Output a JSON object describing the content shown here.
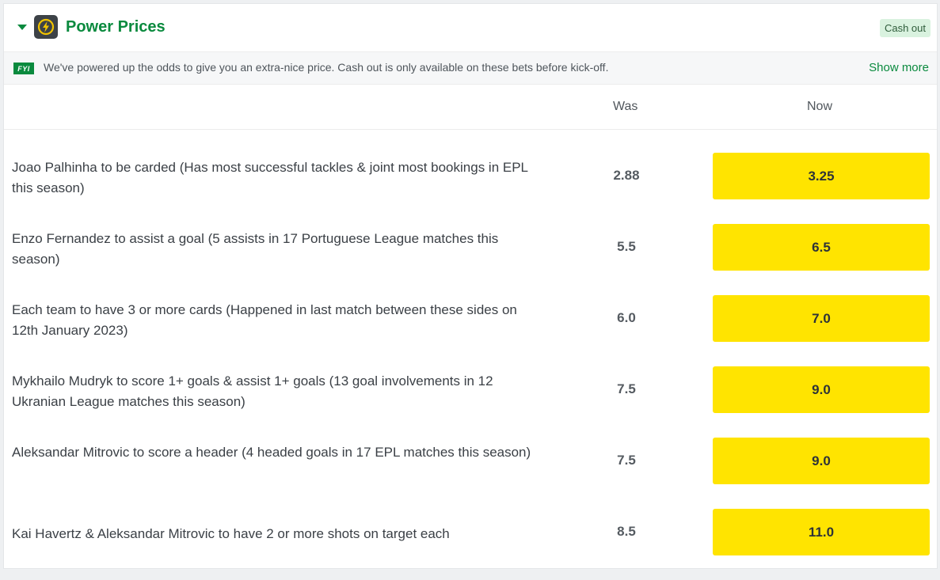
{
  "header": {
    "title": "Power Prices",
    "cash_out_badge": "Cash out"
  },
  "info": {
    "tag": "FYI",
    "text": "We've powered up the odds to give you an extra-nice price. Cash out is only available on these bets before kick-off.",
    "show_more": "Show more"
  },
  "columns": {
    "was": "Was",
    "now": "Now"
  },
  "colors": {
    "brand_green": "#0a8a3e",
    "price_yellow": "#ffe400"
  },
  "icons": {
    "collapse": "caret-down-icon",
    "badge": "lightning-bolt-icon"
  },
  "rows": [
    {
      "desc": "Joao Palhinha to be carded (Has most successful tackles & joint most bookings in EPL this season)",
      "was": "2.88",
      "now": "3.25"
    },
    {
      "desc": "Enzo Fernandez to assist a goal (5 assists in 17 Portuguese League matches this season)",
      "was": "5.5",
      "now": "6.5"
    },
    {
      "desc": "Each team to have 3 or more cards (Happened in last match between these sides on 12th January 2023)",
      "was": "6.0",
      "now": "7.0"
    },
    {
      "desc": "Mykhailo Mudryk to score 1+ goals & assist 1+ goals (13 goal involvements in 12 Ukranian League matches this season)",
      "was": "7.5",
      "now": "9.0"
    },
    {
      "desc": "Aleksandar Mitrovic to score a header (4 headed goals in 17 EPL matches this season)",
      "was": "7.5",
      "now": "9.0"
    },
    {
      "desc": "Kai Havertz & Aleksandar Mitrovic to have 2 or more shots on target each",
      "was": "8.5",
      "now": "11.0"
    }
  ]
}
